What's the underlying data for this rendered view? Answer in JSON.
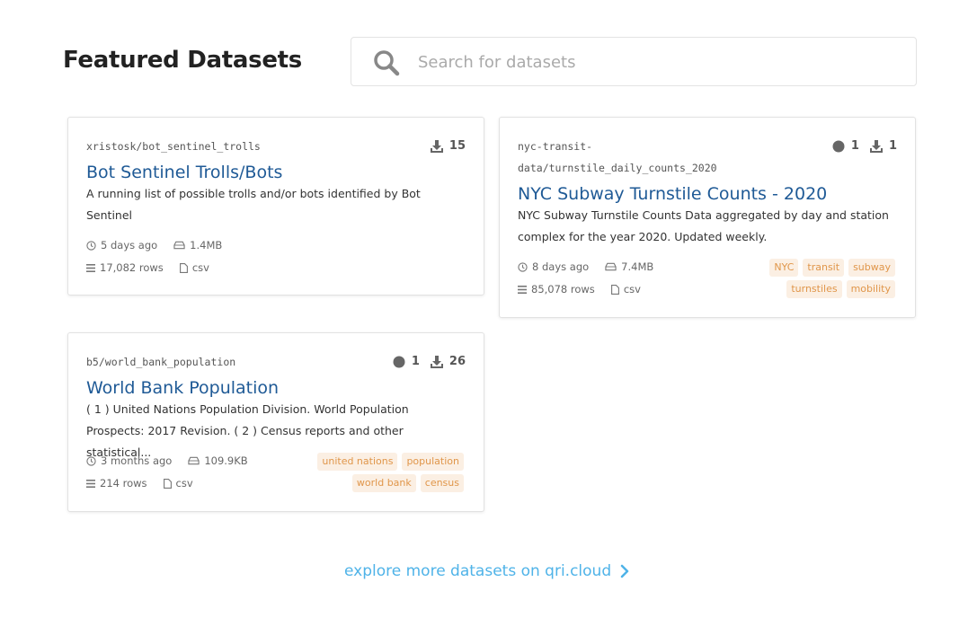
{
  "header": {
    "title": "Featured Datasets",
    "search_placeholder": "Search for datasets"
  },
  "datasets": [
    {
      "ref": "xristosk/bot_sentinel_trolls",
      "downloads": "15",
      "title": "Bot Sentinel Trolls/Bots",
      "description": "A running list of possible trolls and/or bots identified by Bot Sentinel",
      "updated": "5 days ago",
      "size": "1.4MB",
      "rows": "17,082 rows",
      "format": "csv",
      "tags": []
    },
    {
      "ref_line1": "nyc-transit-",
      "ref_line2": "data/turnstile_daily_counts_2020",
      "followers": "1",
      "downloads": "1",
      "title": "NYC Subway Turnstile Counts - 2020",
      "description": "NYC Subway Turnstile Counts Data aggregated by day and station complex for the year 2020. Updated weekly.",
      "updated": "8 days ago",
      "size": "7.4MB",
      "rows": "85,078 rows",
      "format": "csv",
      "tags": [
        "NYC",
        "transit",
        "subway",
        "turnstiles",
        "mobility"
      ]
    },
    {
      "ref": "b5/world_bank_population",
      "followers": "1",
      "downloads": "26",
      "title": "World Bank Population",
      "description": "( 1 ) United Nations Population Division. World Population Prospects: 2017 Revision. ( 2 ) Census reports and other statistical...",
      "updated": "3 months ago",
      "size": "109.9KB",
      "rows": "214 rows",
      "format": "csv",
      "tags": [
        "united nations",
        "population",
        "world bank",
        "census"
      ]
    }
  ],
  "footer": {
    "explore_label": "explore more datasets on qri.cloud"
  },
  "colors": {
    "title_link": "#1f5a96",
    "tag_bg": "#fbefe3",
    "tag_text": "#e0964a",
    "explore_link": "#4fb3e8"
  },
  "icons": [
    "search-icon",
    "download-icon",
    "follower-dot-icon",
    "clock-icon",
    "storage-icon",
    "rows-icon",
    "file-icon",
    "chevron-right-icon"
  ]
}
